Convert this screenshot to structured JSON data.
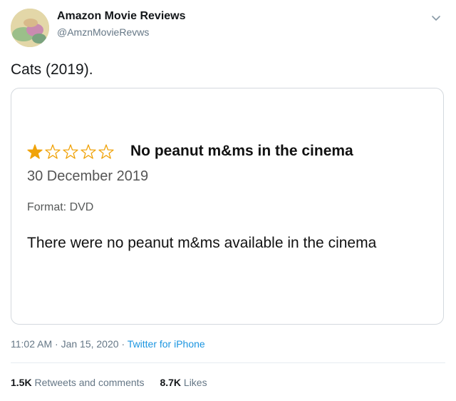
{
  "author": {
    "display_name": "Amazon Movie Reviews",
    "handle": "@AmznMovieRevws"
  },
  "tweet": {
    "text": "Cats (2019).",
    "time": "11:02 AM",
    "date": "Jan 15, 2020",
    "separator": "·",
    "source": "Twitter for iPhone"
  },
  "review": {
    "rating": 1,
    "max_rating": 5,
    "star_color": "#f0a30a",
    "title": "No peanut m&ms in the cinema",
    "date": "30 December 2019",
    "format_label": "Format: DVD",
    "body": "There were no peanut m&ms available in the cinema"
  },
  "stats": {
    "retweets_count": "1.5K",
    "retweets_label": "Retweets and comments",
    "likes_count": "8.7K",
    "likes_label": "Likes"
  },
  "icons": {
    "menu": "chevron-down-icon",
    "avatar": "avatar-image"
  }
}
